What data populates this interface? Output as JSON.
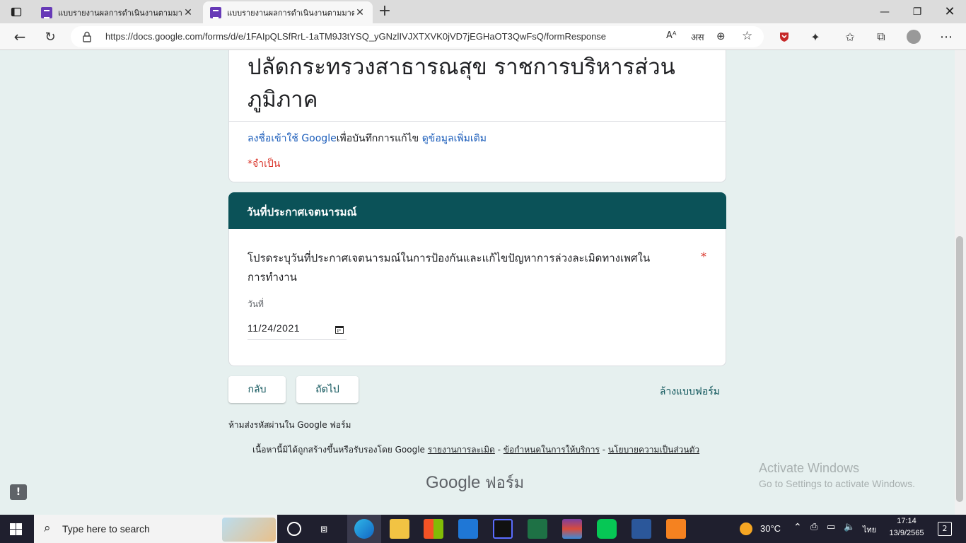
{
  "browser": {
    "tabs": [
      {
        "title": "แบบรายงานผลการดำเนินงานตามมาต"
      },
      {
        "title": "แบบรายงานผลการดำเนินงานตามมาต"
      }
    ],
    "new_tab": "+",
    "url": "https://docs.google.com/forms/d/e/1FAIpQLSfRrL-1aTM9J3tYSQ_yGNzlIVJXTXVK0jVD7jEGHaOT3QwFsQ/formResponse",
    "read_aloud": "Aᴬ",
    "translate": "अस"
  },
  "form": {
    "title_line1": "ปลัดกระทรวงสาธารณสุข ราชการบริหารส่วน",
    "title_line2": "ภูมิภาค",
    "signin_link": "ลงชื่อเข้าใช้ Google",
    "signin_text": "เพื่อบันทึกการแก้ไข",
    "learn_more": "ดูข้อมูลเพิ่มเติม",
    "required_note": "*จำเป็น",
    "section_title": "วันที่ประกาศเจตนารมณ์",
    "question_line1": "โปรดระบุวันที่ประกาศเจตนารมณ์ในการป้องกันและแก้ไขปัญหาการล่วงละเมิดทางเพศใน",
    "question_line2": "การทำงาน",
    "required_star": "*",
    "date_label": "วันที่",
    "date_value": "11/24/2021",
    "back_button": "กลับ",
    "next_button": "ถัดไป",
    "clear_button": "ล้างแบบฟอร์ม",
    "password_warning": "ห้ามส่งรหัสผ่านใน Google ฟอร์ม",
    "footer_text": "เนื้อหานี้มิได้ถูกสร้างขึ้นหรือรับรองโดย Google",
    "footer_link1": "รายงานการละเมิด",
    "footer_sep1": " - ",
    "footer_link2": "ข้อกำหนดในการให้บริการ",
    "footer_sep2": " - ",
    "footer_link3": "นโยบายความเป็นส่วนตัว",
    "logo_google": "Google",
    "logo_forms": "ฟอร์ม"
  },
  "watermark": {
    "line1": "Activate Windows",
    "line2": "Go to Settings to activate Windows."
  },
  "taskbar": {
    "search_placeholder": "Type here to search",
    "temperature": "30°C",
    "language": "ไทย",
    "time": "17:14",
    "date": "13/9/2565",
    "notification_count": "2"
  }
}
